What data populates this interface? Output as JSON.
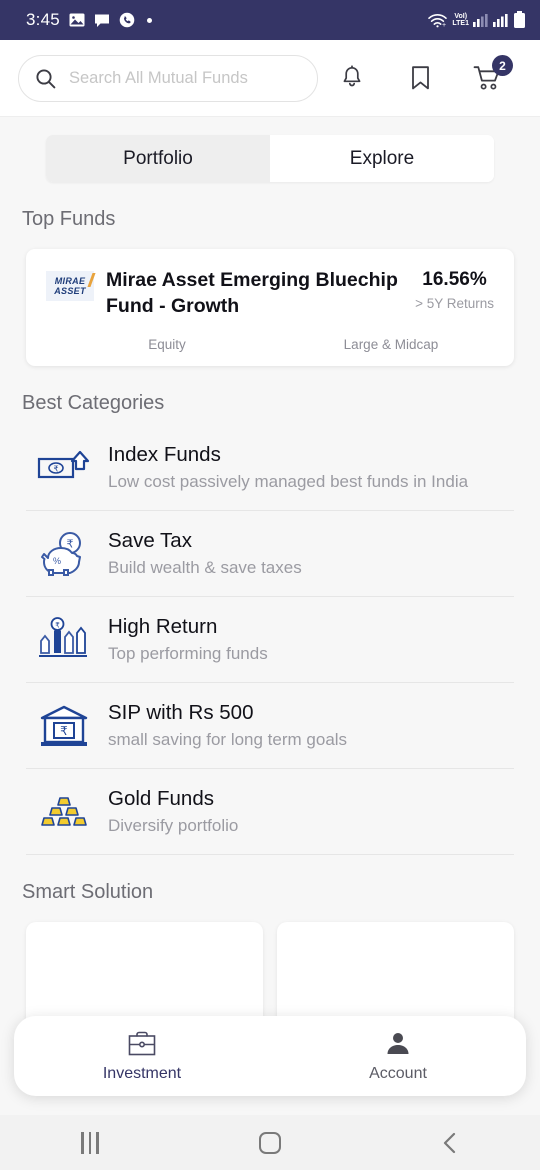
{
  "status_bar": {
    "time": "3:45",
    "left_icons": [
      "image-icon",
      "chat-icon",
      "call-icon",
      "dot-indicator"
    ],
    "network_label": "LTE1",
    "volte_label": "VoI)",
    "right_icons": [
      "wifi-icon",
      "volte-icon",
      "signal-icon",
      "signal-icon",
      "battery-icon"
    ],
    "background": "#353566"
  },
  "header": {
    "search": {
      "placeholder": "Search All Mutual Funds",
      "value": "",
      "icon": "search-icon"
    },
    "notifications_icon": "bell-icon",
    "bookmark_icon": "bookmark-icon",
    "cart_icon": "cart-icon",
    "cart_badge": "2"
  },
  "tabs": [
    {
      "label": "Portfolio",
      "active": false
    },
    {
      "label": "Explore",
      "active": true
    }
  ],
  "top_funds": {
    "title": "Top Funds",
    "card": {
      "logo_line1": "MIRAE",
      "logo_line2": "ASSET",
      "name": "Mirae Asset Emerging Bluechip Fund - Growth",
      "return_value": "16.56%",
      "return_label": "> 5Y Returns",
      "category": "Equity",
      "cap": "Large & Midcap"
    }
  },
  "best_categories": {
    "title": "Best Categories",
    "items": [
      {
        "icon": "banknote-arrow-icon",
        "title": "Index Funds",
        "desc": "Low cost passively managed best funds in India"
      },
      {
        "icon": "piggy-bank-icon",
        "title": "Save Tax",
        "desc": "Build wealth & save taxes"
      },
      {
        "icon": "growth-chart-icon",
        "title": "High Return",
        "desc": "Top performing funds"
      },
      {
        "icon": "bank-rupee-icon",
        "title": "SIP with Rs 500",
        "desc": "small saving for long term goals"
      },
      {
        "icon": "gold-bars-icon",
        "title": "Gold Funds",
        "desc": "Diversify portfolio"
      }
    ]
  },
  "smart_solution": {
    "title": "Smart Solution"
  },
  "bottom_nav": [
    {
      "label": "Investment",
      "icon": "briefcase-icon",
      "active": true
    },
    {
      "label": "Account",
      "icon": "person-icon",
      "active": false
    }
  ],
  "android_nav": {
    "recents": "recents-icon",
    "home": "home-icon",
    "back": "back-icon"
  },
  "colors": {
    "status_bar": "#353566",
    "accent": "#353566",
    "icon_blue": "#1f4496",
    "gold": "#f2cb2f"
  }
}
